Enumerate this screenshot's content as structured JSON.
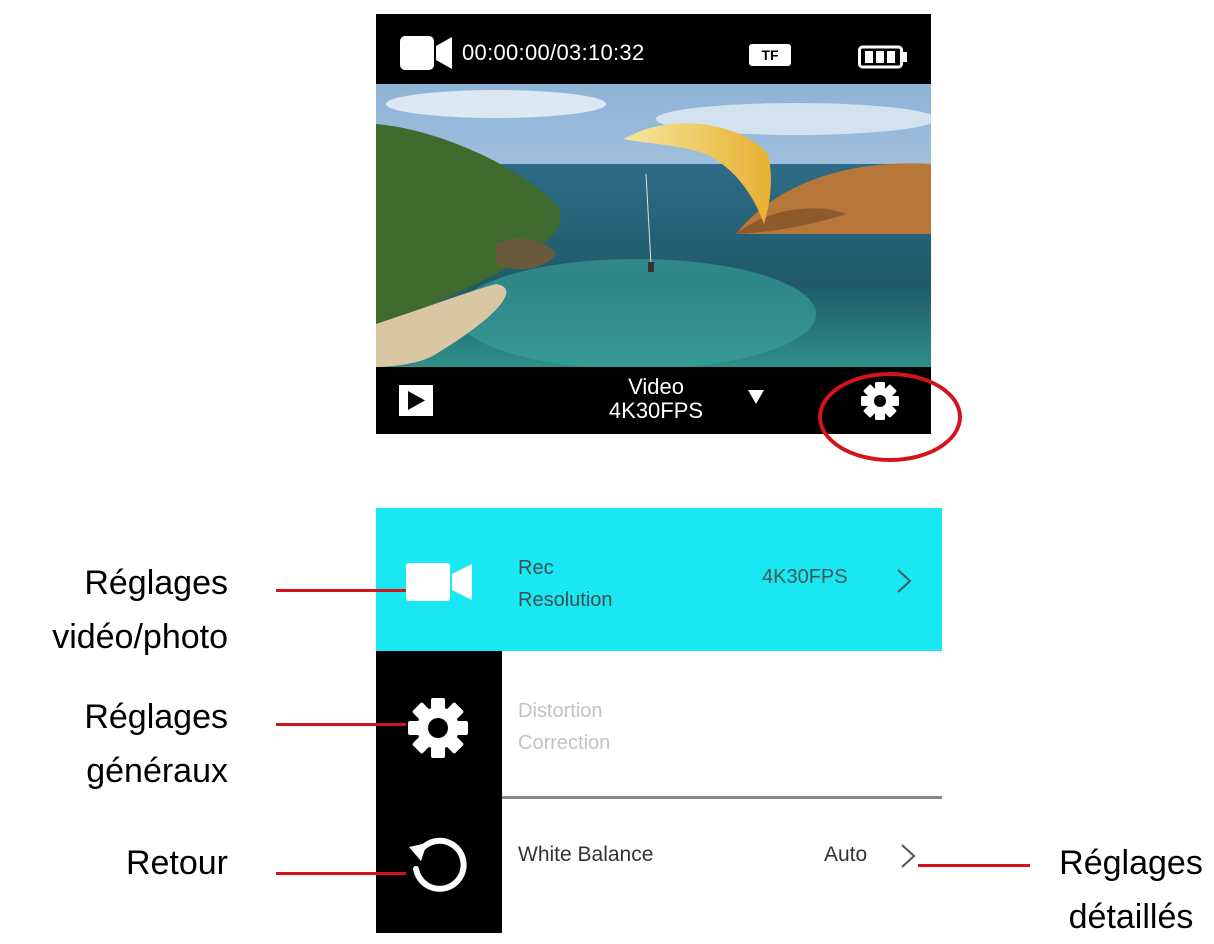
{
  "camera_screen": {
    "timer": "00:00:00/03:10:32",
    "tf_badge": "TF",
    "mode_line1": "Video",
    "mode_line2": "4K30FPS",
    "icons": {
      "record_mode": "video-camera-icon",
      "battery": "battery-icon",
      "playback": "play-icon",
      "mode_dropdown": "caret-down-icon",
      "settings": "gear-icon"
    },
    "highlight_color": "#d4141c"
  },
  "settings_menu": {
    "accent_color": "#19e7f2",
    "rows": [
      {
        "label_line1": "Rec",
        "label_line2": "Resolution",
        "value": "4K30FPS"
      },
      {
        "label_line1": "Distortion",
        "label_line2": "Correction",
        "value": ""
      },
      {
        "label_line1": "White Balance",
        "label_line2": "",
        "value": "Auto"
      }
    ],
    "side_icons": [
      "video-camera-icon",
      "gear-icon",
      "back-icon"
    ]
  },
  "callouts": {
    "video_photo": {
      "line1": "Réglages",
      "line2": "vidéo/photo"
    },
    "general": {
      "line1": "Réglages",
      "line2": "généraux"
    },
    "back": {
      "line1": "Retour"
    },
    "detailed": {
      "line1": "Réglages",
      "line2": "détaillés"
    },
    "line_color": "#d4141c"
  }
}
